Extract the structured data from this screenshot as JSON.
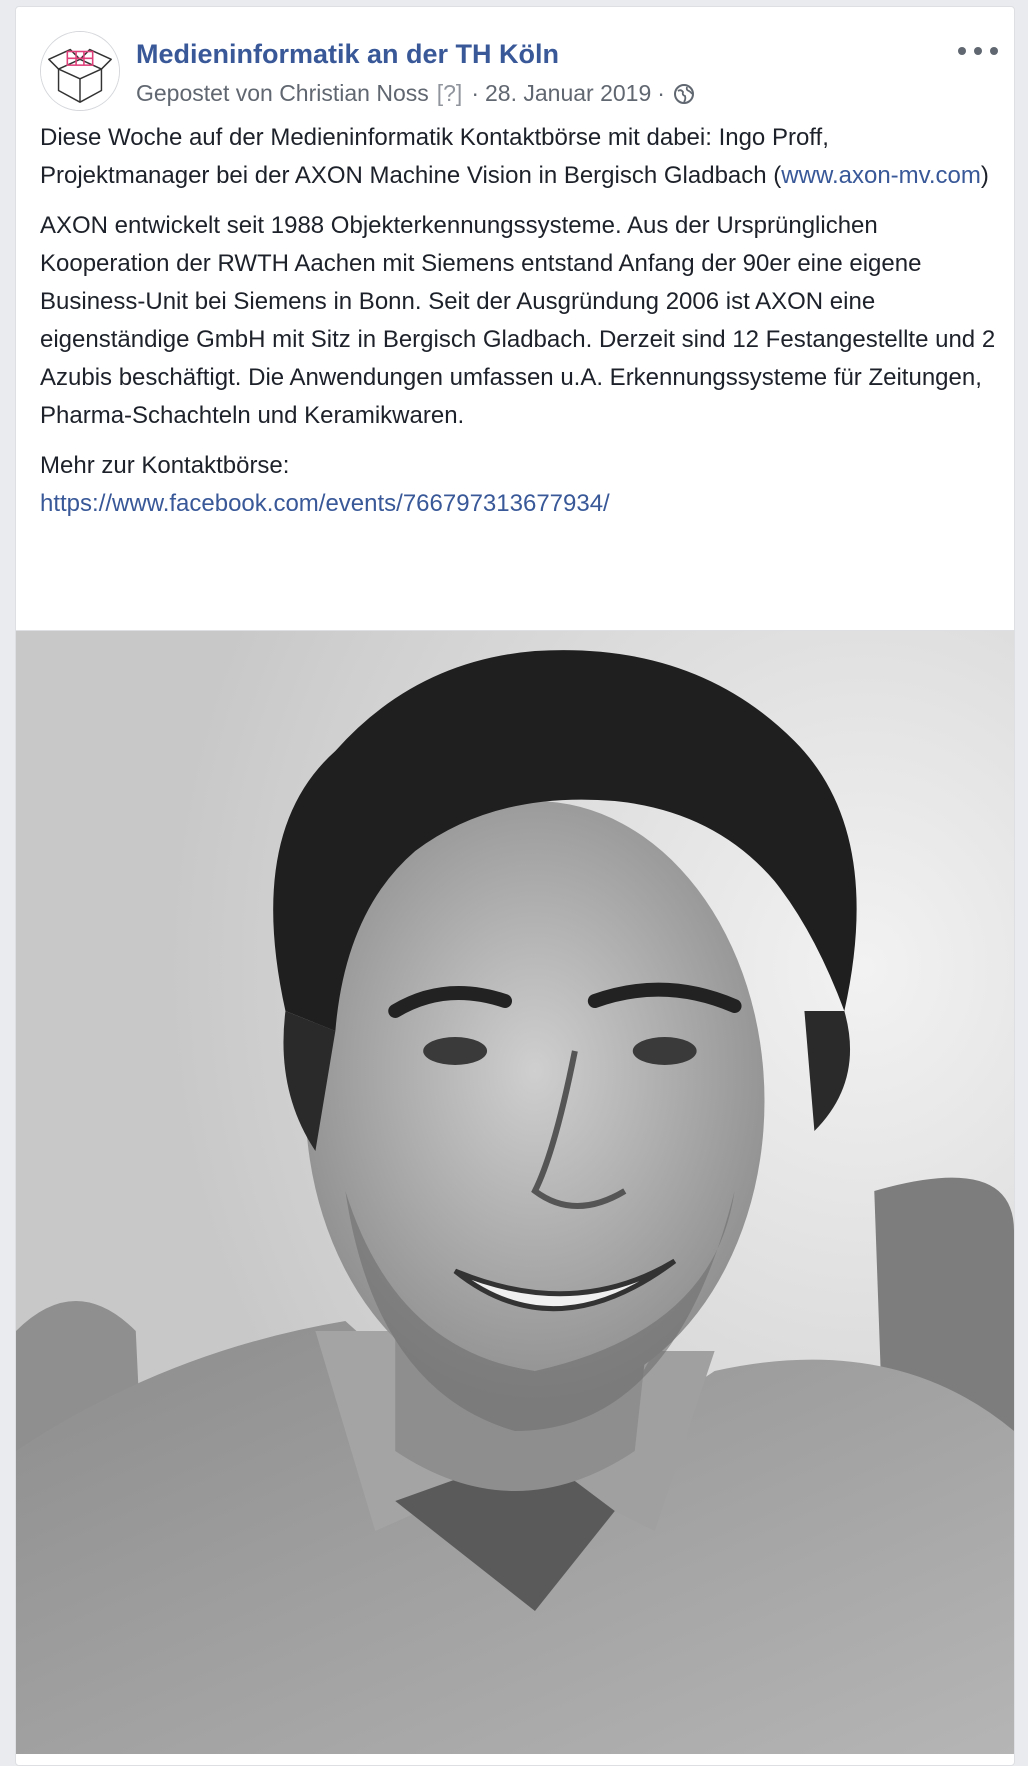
{
  "post": {
    "page_name": "Medieninformatik an der TH Köln",
    "meta": {
      "posted_by": "Gepostet von Christian Noss",
      "help_marker": "[?]",
      "separator": "·",
      "date": "28. Januar 2019",
      "privacy_icon": "globe-icon"
    },
    "more_icon": "more-options-icon",
    "body": {
      "p1_text": "Diese Woche auf der Medieninformatik Kontaktbörse mit dabei: Ingo Proff, Projektmanager bei der AXON Machine Vision in Bergisch Gladbach (",
      "p1_link": "www.axon-mv.com",
      "p1_end": ")",
      "p2": "AXON entwickelt seit 1988 Objekterkennungssysteme. Aus der Ursprünglichen Kooperation der RWTH Aachen mit Siemens entstand Anfang der 90er eine eigene Business-Unit bei Siemens in Bonn. Seit der Ausgründung 2006 ist AXON eine eigenständige GmbH mit Sitz in Bergisch Gladbach. Derzeit sind 12 Festangestellte und 2 Azubis beschäftigt. Die Anwendungen umfassen u.A. Erkennungssysteme für Zeitungen, Pharma-Schachteln und Keramikwaren.",
      "p3_text": "Mehr zur Kontaktbörse:",
      "p3_link": "https://www.facebook.com/events/766797313677934/"
    },
    "colors": {
      "link": "#385898",
      "text": "#1d2129",
      "meta": "#616770",
      "background": "#e9ebee"
    }
  }
}
